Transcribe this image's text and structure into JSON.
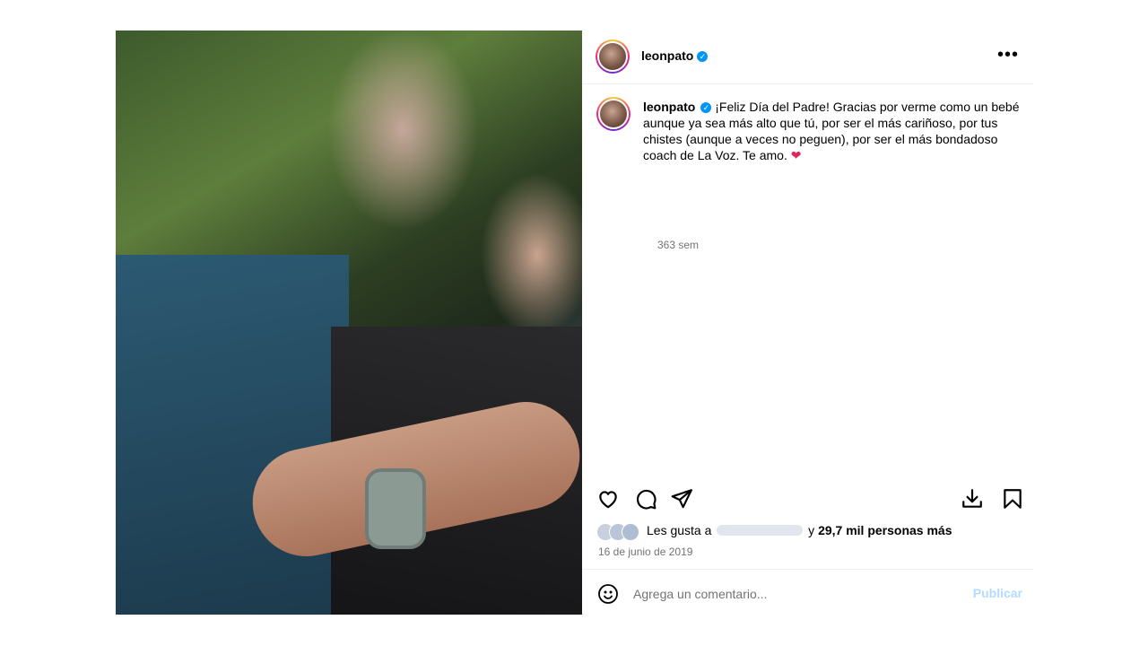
{
  "post": {
    "username": "leonpato",
    "verified": true,
    "caption": "¡Feliz Día del Padre! Gracias por verme como un bebé aunque ya sea más alto que tú, por ser el más cariñoso, por tus chistes (aunque a veces no peguen), por ser el más bondadoso coach de La Voz. Te amo.",
    "caption_emoji": "❤",
    "time_ago": "363 sem",
    "date": "16 de junio de 2019"
  },
  "likes": {
    "prefix": "Les gusta a",
    "conjunction": "y",
    "count_text": "29,7 mil personas más"
  },
  "comment": {
    "placeholder": "Agrega un comentario...",
    "publish_label": "Publicar"
  },
  "icons": {
    "more": "more-options-icon",
    "like": "heart-icon",
    "comment": "comment-bubble-icon",
    "share": "paper-plane-icon",
    "download": "download-icon",
    "save": "bookmark-icon",
    "emoji": "emoji-icon",
    "verified": "verified-badge-icon"
  },
  "colors": {
    "verified": "#0095f6",
    "publish_disabled": "#b3dbff",
    "muted_text": "#737373"
  }
}
